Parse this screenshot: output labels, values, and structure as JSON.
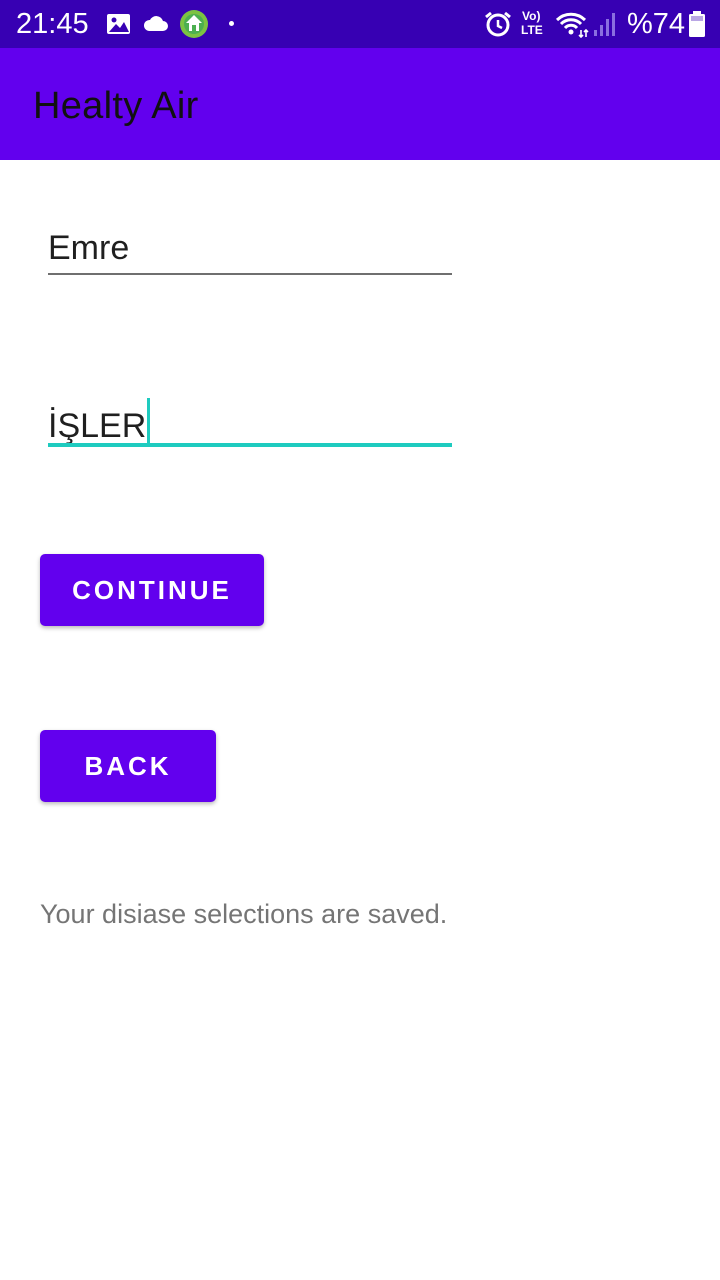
{
  "status_bar": {
    "time": "21:45",
    "battery_percent": "%74",
    "lte_label": "LTE",
    "volte_label": "Vo)",
    "icons": [
      "gallery-icon",
      "cloud-icon",
      "app-notification-icon",
      "notification-dot",
      "alarm-icon",
      "volte-icon",
      "wifi-icon",
      "signal-icon",
      "battery-icon"
    ],
    "background_color": "#3700b3"
  },
  "app_bar": {
    "title": "Healty Air",
    "background_color": "#6200ee"
  },
  "form": {
    "first_name_value": "Emre",
    "last_name_value": "İŞLER",
    "focused_field": "last_name",
    "accent_color": "#1ecbbf"
  },
  "buttons": {
    "continue_label": "CONTINUE",
    "back_label": "BACK",
    "color": "#6200ee"
  },
  "message": {
    "text": "Your disiase selections are saved."
  }
}
